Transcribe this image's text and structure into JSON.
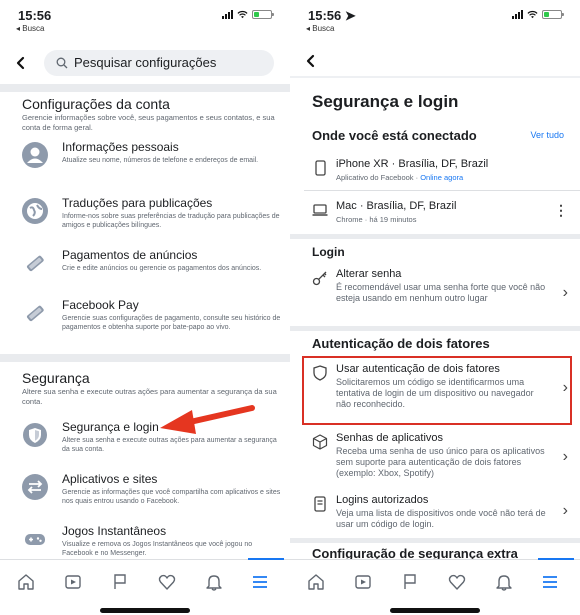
{
  "left": {
    "status": {
      "time": "15:56",
      "back_app": "◂ Busca"
    },
    "search": {
      "placeholder": "Pesquisar configurações"
    },
    "account": {
      "title": "Configurações da conta",
      "description": "Gerencie informações sobre você, seus pagamentos e seus contatos, e sua conta de forma geral.",
      "items": [
        {
          "label": "Informações pessoais",
          "desc": "Atualize seu nome, números de telefone e endereços de email.",
          "icon": "person-icon"
        },
        {
          "label": "Traduções para publicações",
          "desc": "Informe-nos sobre suas preferências de tradução para publicações de amigos e publicações bilíngues.",
          "icon": "globe-icon"
        },
        {
          "label": "Pagamentos de anúncios",
          "desc": "Crie e edite anúncios ou gerencie os pagamentos dos anúncios.",
          "icon": "tag-icon"
        },
        {
          "label": "Facebook Pay",
          "desc": "Gerencie suas configurações de pagamento, consulte seu histórico de pagamentos e obtenha suporte por bate-papo ao vivo.",
          "icon": "pencil-tag-icon"
        }
      ]
    },
    "security": {
      "title": "Segurança",
      "description": "Altere sua senha e execute outras ações para aumentar a segurança da sua conta.",
      "items": [
        {
          "label": "Segurança e login",
          "desc": "Altere sua senha e execute outras ações para aumentar a segurança da sua conta.",
          "icon": "shield-icon"
        },
        {
          "label": "Aplicativos e sites",
          "desc": "Gerencie as informações que você compartilha com aplicativos e sites nos quais entrou usando o Facebook.",
          "icon": "arrows-icon"
        },
        {
          "label": "Jogos Instantâneos",
          "desc": "Visualize e remova os Jogos Instantâneos que você jogou no Facebook e no Messenger.",
          "icon": "gamepad-icon"
        }
      ]
    }
  },
  "right": {
    "status": {
      "time": "15:56 ➤",
      "back_app": "◂ Busca"
    },
    "title": "Segurança e login",
    "where": {
      "title": "Onde você está conectado",
      "see_all": "Ver tudo",
      "devices": [
        {
          "label": "iPhone XR · Brasília, DF, Brazil",
          "desc_app": "Aplicativo do Facebook · ",
          "desc_status": "Online agora"
        },
        {
          "label": "Mac · Brasília, DF, Brazil",
          "desc_app": "Chrome · há 19 minutos",
          "desc_status": ""
        }
      ]
    },
    "login": {
      "title": "Login",
      "change_password": {
        "label": "Alterar senha",
        "desc": "É recomendável usar uma senha forte que você não esteja usando em nenhum outro lugar"
      }
    },
    "two_factor": {
      "title": "Autenticação de dois fatores",
      "items": [
        {
          "label": "Usar autenticação de dois fatores",
          "desc": "Solicitaremos um código se identificarmos uma tentativa de login de um dispositivo ou navegador não reconhecido."
        },
        {
          "label": "Senhas de aplicativos",
          "desc": "Receba uma senha de uso único para os aplicativos sem suporte para autenticação de dois fatores (exemplo: Xbox, Spotify)"
        },
        {
          "label": "Logins autorizados",
          "desc": "Veja uma lista de dispositivos onde você não terá de usar um código de login."
        }
      ]
    },
    "extra": {
      "title": "Configuração de segurança extra"
    }
  },
  "tabs": [
    "home-icon",
    "watch-icon",
    "flag-icon",
    "heart-icon",
    "bell-icon",
    "menu-icon"
  ],
  "colors": {
    "accent": "#1877f2",
    "highlight": "#d93025",
    "arrow": "#e53620"
  }
}
